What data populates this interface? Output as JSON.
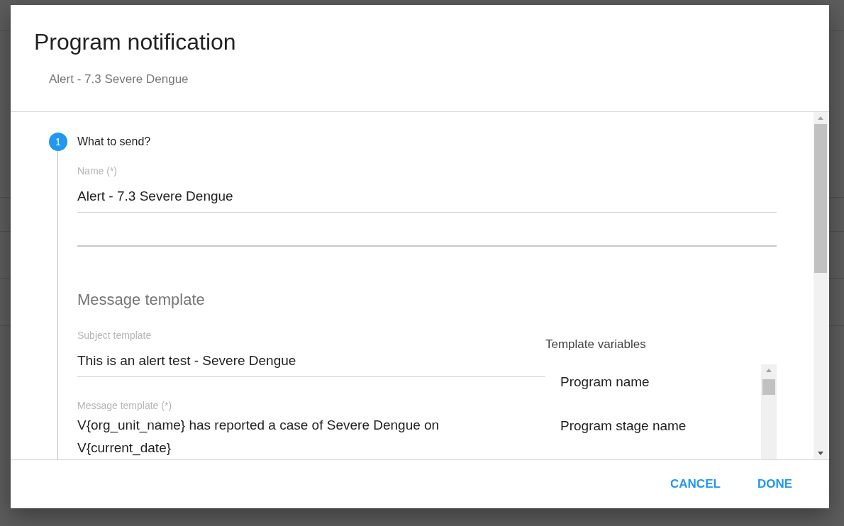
{
  "dialog": {
    "title": "Program notification",
    "subtitle": "Alert - 7.3 Severe Dengue"
  },
  "step": {
    "number": "1",
    "title": "What to send?"
  },
  "name_field": {
    "label": "Name (*)",
    "value": "Alert - 7.3 Severe Dengue"
  },
  "section_title": "Message template",
  "subject_field": {
    "label": "Subject template",
    "value": "This is an alert test - Severe Dengue"
  },
  "message_field": {
    "label": "Message template (*)",
    "value": "V{org_unit_name} has reported a case of Severe Dengue on V{current_date}"
  },
  "template_variables": {
    "title": "Template variables",
    "items": [
      "Program name",
      "Program stage name"
    ]
  },
  "buttons": [
    "CANCEL",
    "DONE"
  ]
}
